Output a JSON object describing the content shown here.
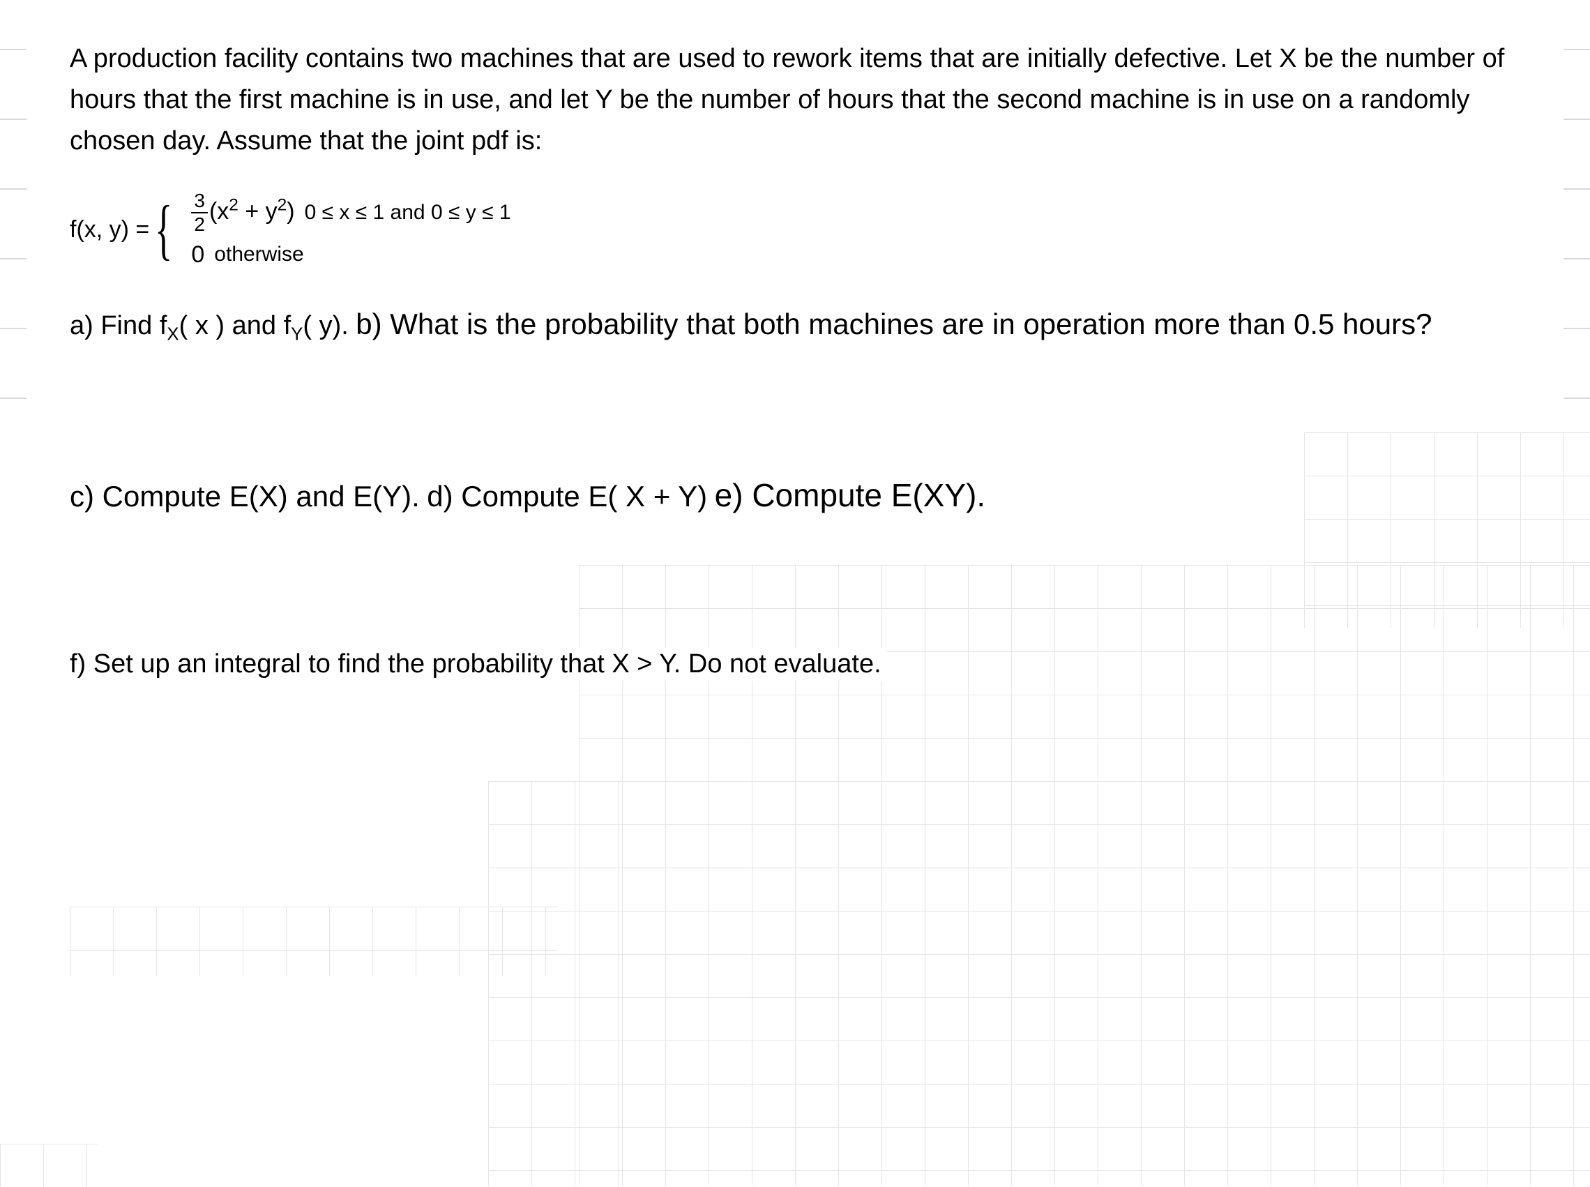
{
  "intro": "A production facility contains two machines that are used to rework items that are initially defective. Let X be the number of hours that the first machine is in use, and let Y be the number of hours that the second machine is in use on a randomly chosen day. Assume that the joint pdf is:",
  "formula": {
    "lhs": "f(x, y) = ",
    "frac_num": "3",
    "frac_den": "2",
    "poly_open": "(x",
    "exp1": "2",
    "plus": " + y",
    "exp2": "2",
    "poly_close": ")",
    "cond1": "0 ≤ x ≤ 1 and 0 ≤ y ≤ 1",
    "zero": "0",
    "cond2": "otherwise"
  },
  "questions": {
    "a_prefix": "a) Find f",
    "a_subX": "X",
    "a_mid1": "( x ) and f",
    "a_subY": "Y",
    "a_end": "( y).",
    "b": "b) What is the probability that both machines are in operation more than 0.5 hours?",
    "c": "c) Compute E(X) and E(Y).",
    "d": "d) Compute E( X + Y)",
    "e": "e) Compute E(XY).",
    "f": "f) Set up an integral to find the probability that X > Y.  Do not evaluate."
  }
}
